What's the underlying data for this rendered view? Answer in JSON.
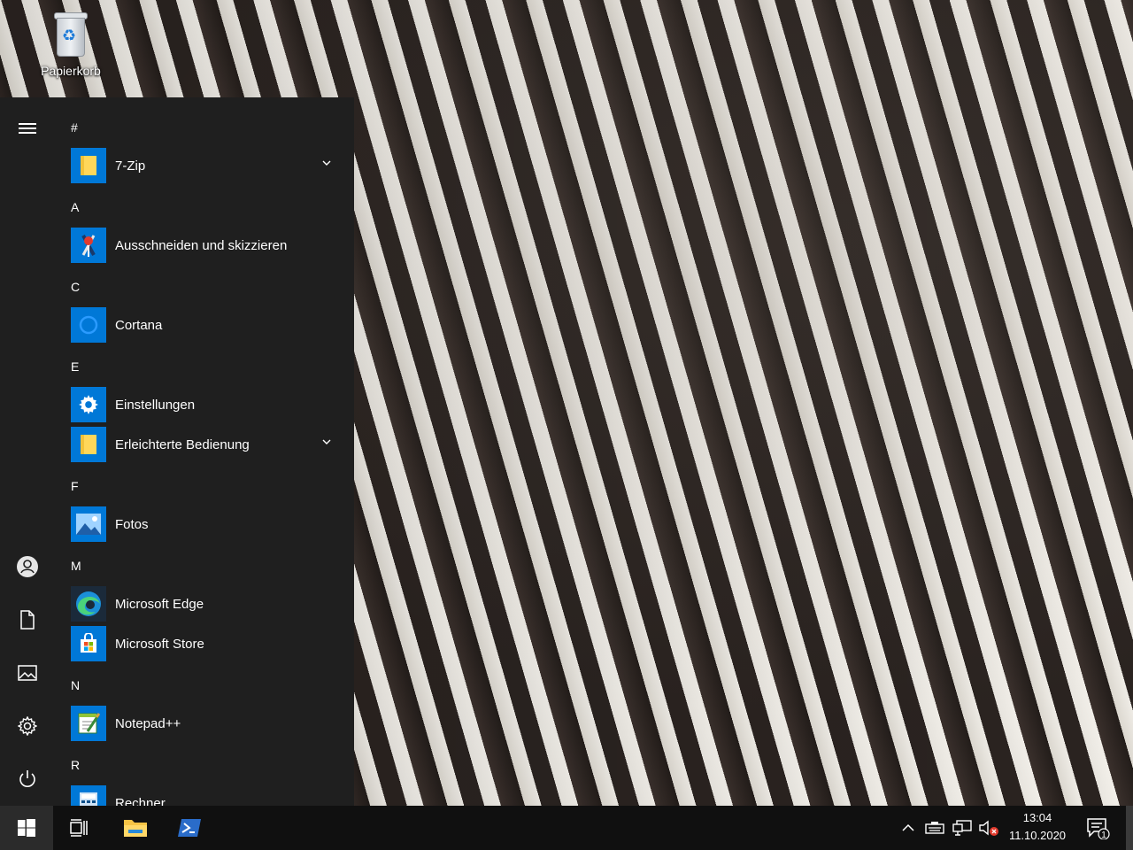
{
  "desktop": {
    "recycle_bin_label": "Papierkorb"
  },
  "start_menu": {
    "rail": {
      "menu_icon": "hamburger-icon",
      "user_icon": "user-icon",
      "documents_icon": "document-icon",
      "pictures_icon": "pictures-icon",
      "settings_icon": "gear-icon",
      "power_icon": "power-icon"
    },
    "groups": [
      {
        "letter": "#"
      },
      {
        "letter": "A"
      },
      {
        "letter": "C"
      },
      {
        "letter": "E"
      },
      {
        "letter": "F"
      },
      {
        "letter": "M"
      },
      {
        "letter": "N"
      },
      {
        "letter": "R"
      }
    ],
    "apps": [
      {
        "label": "7-Zip",
        "icon": "folder-icon",
        "expandable": true
      },
      {
        "label": "Ausschneiden und skizzieren",
        "icon": "snip-sketch-icon"
      },
      {
        "label": "Cortana",
        "icon": "cortana-icon"
      },
      {
        "label": "Einstellungen",
        "icon": "gear-icon"
      },
      {
        "label": "Erleichterte Bedienung",
        "icon": "folder-icon",
        "expandable": true
      },
      {
        "label": "Fotos",
        "icon": "photos-icon"
      },
      {
        "label": "Microsoft Edge",
        "icon": "edge-icon"
      },
      {
        "label": "Microsoft Store",
        "icon": "store-icon"
      },
      {
        "label": "Notepad++",
        "icon": "notepad-plus-plus-icon"
      },
      {
        "label": "Rechner",
        "icon": "calculator-icon"
      }
    ]
  },
  "taskbar": {
    "start_icon": "windows-logo-icon",
    "task_view_icon": "task-view-icon",
    "pinned": [
      "file-explorer-icon",
      "powershell-icon"
    ],
    "tray_icons": [
      "chevron-up-icon",
      "keyboard-icon",
      "network-icon",
      "volume-muted-icon"
    ],
    "time": "13:04",
    "date": "11.10.2020",
    "notification_count": "1"
  },
  "colors": {
    "accent": "#0078d7",
    "start_menu_bg": "#1f1f1f",
    "taskbar_bg": "#101010"
  }
}
